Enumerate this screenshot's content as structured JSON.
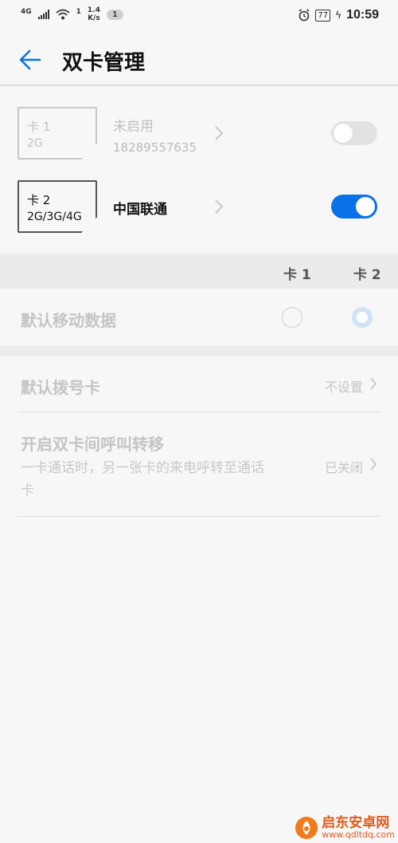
{
  "status_bar": {
    "network_type": "4G",
    "speed_value": "1.4",
    "speed_unit": "K/s",
    "wifi_index": "1",
    "notification_count": "1",
    "battery_level": "77",
    "time": "10:59"
  },
  "header": {
    "title": "双卡管理"
  },
  "sim_cards": [
    {
      "card_label": "卡 1",
      "network": "2G",
      "carrier": "未启用",
      "number": "18289557635",
      "enabled": false
    },
    {
      "card_label": "卡 2",
      "network": "2G/3G/4G",
      "carrier": "中国联通",
      "number": "",
      "enabled": true
    }
  ],
  "columns": {
    "card1": "卡 1",
    "card2": "卡 2"
  },
  "default_data": {
    "label": "默认移动数据",
    "selected": "card2"
  },
  "default_dial": {
    "label": "默认拨号卡",
    "value": "不设置"
  },
  "call_forward": {
    "label": "开启双卡间呼叫转移",
    "description": "一卡通话时，另一张卡的来电呼转至通话卡",
    "value": "已关闭"
  },
  "watermark": {
    "name": "启东安卓网",
    "url": "www.qdltdq.com"
  },
  "colors": {
    "accent": "#0a72e8",
    "background": "#f7f7f7",
    "section_band": "#ebebeb"
  }
}
